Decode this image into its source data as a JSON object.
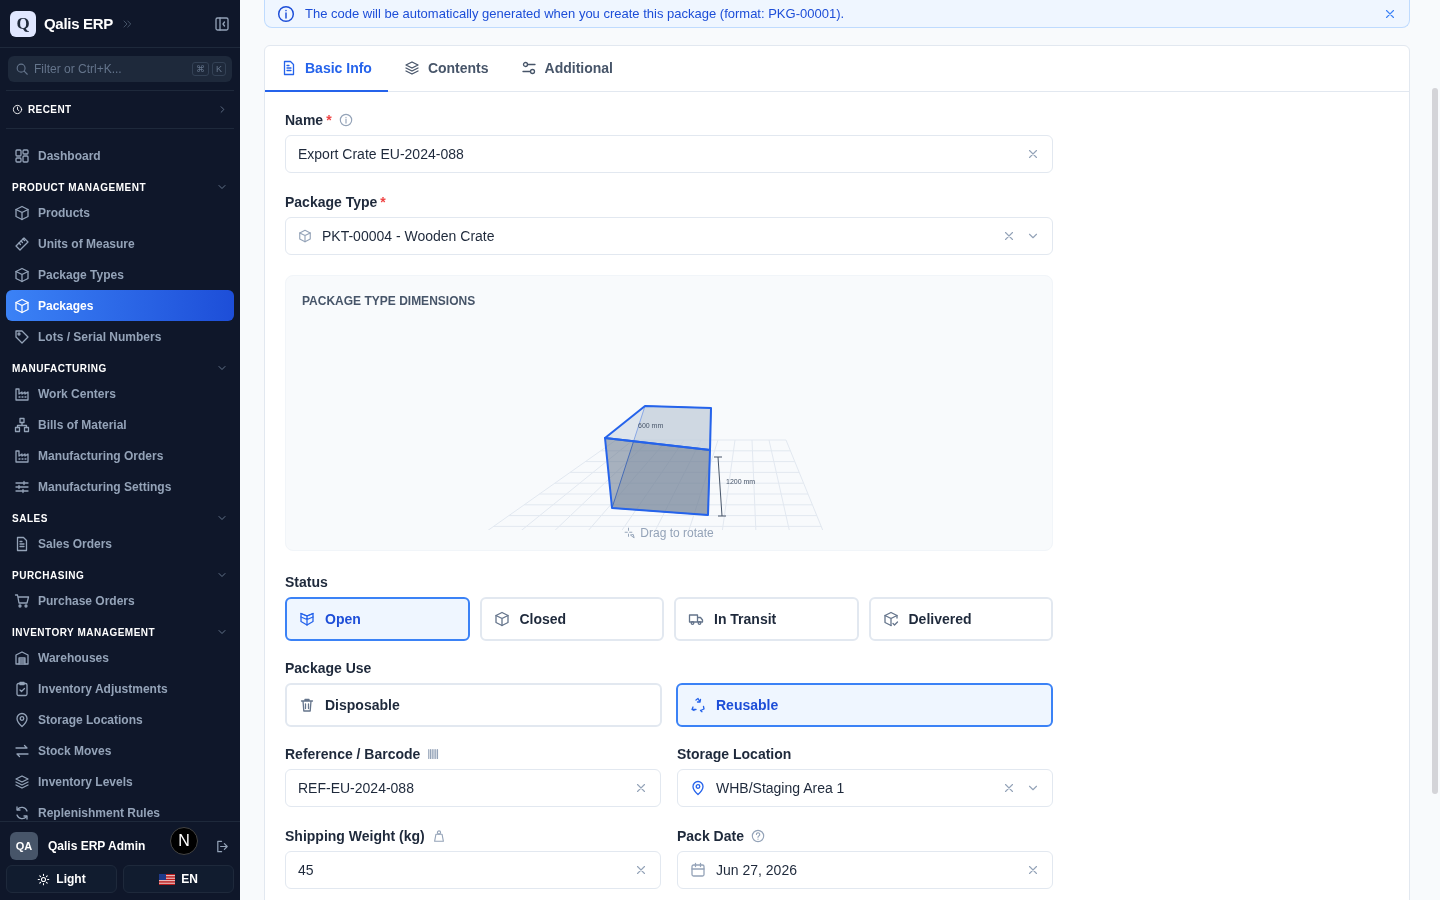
{
  "app": {
    "logo_letter": "Q",
    "name": "Qalis ERP"
  },
  "sidebar": {
    "search": {
      "placeholder": "Filter or Ctrl+K...",
      "keys": [
        "⌘",
        "K"
      ]
    },
    "recent": "RECENT",
    "top_items": [
      {
        "label": "Dashboard",
        "selected": false
      }
    ],
    "sections": [
      {
        "title": "PRODUCT MANAGEMENT",
        "expanded": true,
        "items": [
          {
            "label": "Products",
            "selected": false
          },
          {
            "label": "Units of Measure",
            "selected": false
          },
          {
            "label": "Package Types",
            "selected": false
          },
          {
            "label": "Packages",
            "selected": true
          },
          {
            "label": "Lots / Serial Numbers",
            "selected": false
          }
        ]
      },
      {
        "title": "MANUFACTURING",
        "expanded": true,
        "items": [
          {
            "label": "Work Centers",
            "selected": false
          },
          {
            "label": "Bills of Material",
            "selected": false
          },
          {
            "label": "Manufacturing Orders",
            "selected": false
          },
          {
            "label": "Manufacturing Settings",
            "selected": false
          }
        ]
      },
      {
        "title": "SALES",
        "expanded": true,
        "items": [
          {
            "label": "Sales Orders",
            "selected": false
          }
        ]
      },
      {
        "title": "PURCHASING",
        "expanded": true,
        "items": [
          {
            "label": "Purchase Orders",
            "selected": false
          }
        ]
      },
      {
        "title": "INVENTORY MANAGEMENT",
        "expanded": true,
        "items": [
          {
            "label": "Warehouses",
            "selected": false
          },
          {
            "label": "Inventory Adjustments",
            "selected": false
          },
          {
            "label": "Storage Locations",
            "selected": false
          },
          {
            "label": "Stock Moves",
            "selected": false
          },
          {
            "label": "Inventory Levels",
            "selected": false
          },
          {
            "label": "Replenishment Rules",
            "selected": false
          }
        ]
      }
    ],
    "user": {
      "initials": "QA",
      "name": "Qalis ERP Admin"
    },
    "theme_button": "Light",
    "language_button": "EN"
  },
  "dev_badge": "N",
  "notice": "The code will be automatically generated when you create this package (format: PKG-00001).",
  "tabs": [
    {
      "label": "Basic Info",
      "selected": true
    },
    {
      "label": "Contents",
      "selected": false
    },
    {
      "label": "Additional",
      "selected": false
    }
  ],
  "form": {
    "name": {
      "label": "Name",
      "required_mark": "*",
      "value": "Export Crate EU-2024-088"
    },
    "package_type": {
      "label": "Package Type",
      "required_mark": "*",
      "value": "PKT-00004 - Wooden Crate"
    },
    "dimensions": {
      "title": "PACKAGE TYPE DIMENSIONS",
      "labels": [
        "600 mm",
        "1200 mm"
      ],
      "hint": "Drag to rotate"
    },
    "status": {
      "label": "Status",
      "options": [
        {
          "label": "Open",
          "selected": true
        },
        {
          "label": "Closed",
          "selected": false
        },
        {
          "label": "In Transit",
          "selected": false
        },
        {
          "label": "Delivered",
          "selected": false
        }
      ]
    },
    "package_use": {
      "label": "Package Use",
      "options": [
        {
          "label": "Disposable",
          "selected": false
        },
        {
          "label": "Reusable",
          "selected": true
        }
      ]
    },
    "reference": {
      "label": "Reference / Barcode",
      "value": "REF-EU-2024-088"
    },
    "storage_location": {
      "label": "Storage Location",
      "value": "WHB/Staging Area 1"
    },
    "shipping_weight": {
      "label": "Shipping Weight (kg)",
      "value": "45"
    },
    "pack_date": {
      "label": "Pack Date",
      "value": "Jun 27, 2026"
    }
  }
}
